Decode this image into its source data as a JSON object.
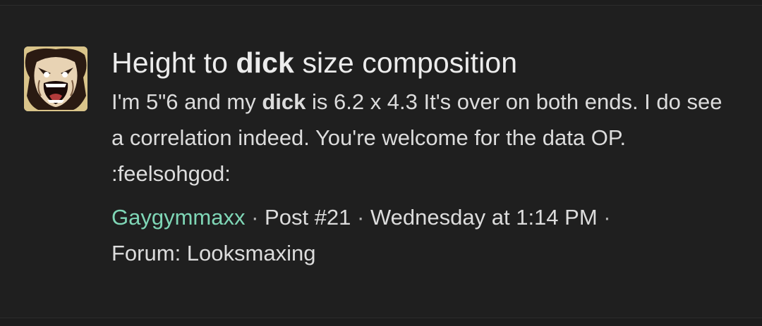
{
  "result": {
    "title_before": "Height to ",
    "title_highlight": "dick",
    "title_after": " size composition",
    "snippet_before": "I'm 5\"6 and my ",
    "snippet_highlight": "dick",
    "snippet_after": " is 6.2 x 4.3 It's over on both ends. I do see a correlation indeed. You're welcome for the data OP. :feelsohgod:",
    "meta": {
      "username": "Gaygymmaxx",
      "separator": " · ",
      "post_label": "Post #21",
      "date": "Wednesday at 1:14 PM",
      "forum": "Forum: Looksmaxing"
    },
    "avatar_icon": "avatar-screaming-face-icon"
  },
  "colors": {
    "background": "#1f1f1f",
    "text": "#dcdcdc",
    "title": "#ececec",
    "username": "#7fd6b6"
  }
}
